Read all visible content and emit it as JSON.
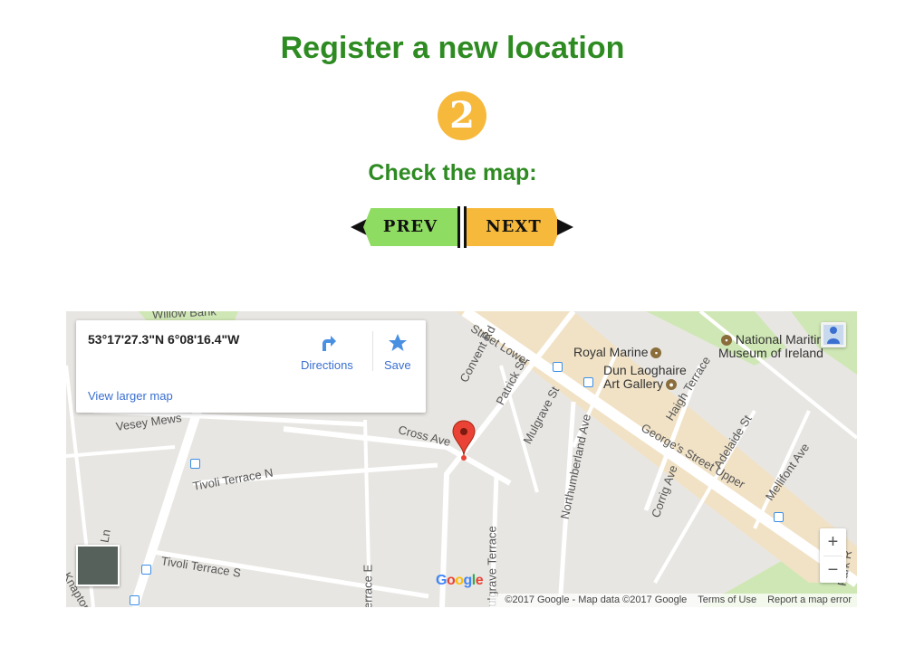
{
  "page": {
    "title": "Register a new location",
    "step_number": "2",
    "subtitle": "Check the map:"
  },
  "nav": {
    "prev_label": "PREV",
    "next_label": "NEXT"
  },
  "map": {
    "info_card": {
      "coordinates": "53°17'27.3\"N 6°08'16.4\"W",
      "directions_label": "Directions",
      "save_label": "Save",
      "view_larger_label": "View larger map"
    },
    "streets": [
      "Willow Bank",
      "Vesey Mews",
      "Tivoli Terrace N",
      "Tivoli Terrace S",
      "Cross Ave",
      "Convent Rd",
      "Patrick St",
      "Mulgrave St",
      "Northumberland Ave",
      "George's Street Upper",
      "Haigh Terrace",
      "Adelaide St",
      "Mellifont Ave",
      "Corrig Ave",
      "Mulgrave Terrace",
      "Terrace E",
      "Street Lower",
      "Knapton",
      "Ln",
      "Park R"
    ],
    "pois": [
      {
        "name": "Royal Marine"
      },
      {
        "name": "Dun Laoghaire Art Gallery"
      },
      {
        "name": "National Maritime Museum of Ireland"
      }
    ],
    "google_logo": "Google",
    "attribution": "©2017 Google - Map data ©2017 Google",
    "terms_label": "Terms of Use",
    "report_label": "Report a map error",
    "zoom_in": "+",
    "zoom_out": "−"
  },
  "colors": {
    "title_green": "#2e8b22",
    "badge_orange": "#f6b93b",
    "prev_green": "#8fdc62",
    "next_orange": "#f6b93b",
    "map_bg": "#e5e3df",
    "link_blue": "#3a6fd0",
    "pin_red": "#ea4335"
  }
}
